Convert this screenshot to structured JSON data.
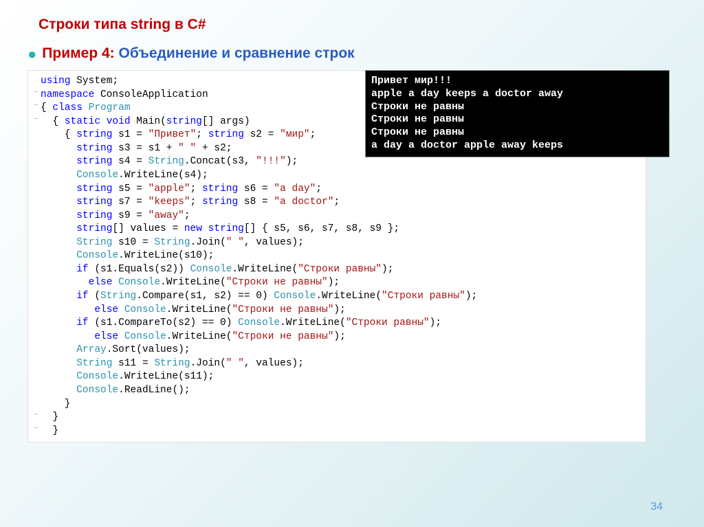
{
  "title": "Строки типа string в C#",
  "subtitle_prefix": "Пример 4:",
  "subtitle_text": " Объединение и сравнение строк",
  "page_number": "34",
  "console_output": [
    "Привет мир!!!",
    "apple a day keeps a doctor away",
    "Строки не равны",
    "Строки не равны",
    "Строки не равны",
    "a day a doctor apple away keeps"
  ],
  "code": {
    "lines": [
      {
        "g": " ",
        "tokens": [
          [
            "kw",
            "using"
          ],
          [
            "punc",
            " "
          ],
          [
            "ident",
            "System"
          ],
          [
            "punc",
            ";"
          ]
        ]
      },
      {
        "g": "−",
        "tokens": [
          [
            "kw",
            "namespace"
          ],
          [
            "punc",
            " "
          ],
          [
            "ident",
            "ConsoleApplication"
          ]
        ]
      },
      {
        "g": "−",
        "tokens": [
          [
            "punc",
            "{ "
          ],
          [
            "kw",
            "class"
          ],
          [
            "punc",
            " "
          ],
          [
            "type",
            "Program"
          ]
        ]
      },
      {
        "g": "−",
        "tokens": [
          [
            "punc",
            "  { "
          ],
          [
            "kw",
            "static"
          ],
          [
            "punc",
            " "
          ],
          [
            "kw",
            "void"
          ],
          [
            "punc",
            " "
          ],
          [
            "ident",
            "Main"
          ],
          [
            "punc",
            "("
          ],
          [
            "kw",
            "string"
          ],
          [
            "punc",
            "[] args)"
          ]
        ]
      },
      {
        "g": " ",
        "tokens": [
          [
            "punc",
            "    { "
          ],
          [
            "kw",
            "string"
          ],
          [
            "punc",
            " s1 = "
          ],
          [
            "str",
            "\"Привет\""
          ],
          [
            "punc",
            "; "
          ],
          [
            "kw",
            "string"
          ],
          [
            "punc",
            " s2 = "
          ],
          [
            "str",
            "\"мир\""
          ],
          [
            "punc",
            ";"
          ]
        ]
      },
      {
        "g": " ",
        "tokens": [
          [
            "punc",
            "      "
          ],
          [
            "kw",
            "string"
          ],
          [
            "punc",
            " s3 = s1 + "
          ],
          [
            "str",
            "\" \""
          ],
          [
            "punc",
            " + s2;"
          ]
        ]
      },
      {
        "g": " ",
        "tokens": [
          [
            "punc",
            "      "
          ],
          [
            "kw",
            "string"
          ],
          [
            "punc",
            " s4 = "
          ],
          [
            "type",
            "String"
          ],
          [
            "punc",
            ".Concat(s3, "
          ],
          [
            "str",
            "\"!!!\""
          ],
          [
            "punc",
            ");"
          ]
        ]
      },
      {
        "g": " ",
        "tokens": [
          [
            "punc",
            "      "
          ],
          [
            "type",
            "Console"
          ],
          [
            "punc",
            ".WriteLine(s4);"
          ]
        ]
      },
      {
        "g": " ",
        "tokens": [
          [
            "punc",
            "      "
          ],
          [
            "kw",
            "string"
          ],
          [
            "punc",
            " s5 = "
          ],
          [
            "str",
            "\"apple\""
          ],
          [
            "punc",
            "; "
          ],
          [
            "kw",
            "string"
          ],
          [
            "punc",
            " s6 = "
          ],
          [
            "str",
            "\"a day\""
          ],
          [
            "punc",
            ";"
          ]
        ]
      },
      {
        "g": " ",
        "tokens": [
          [
            "punc",
            "      "
          ],
          [
            "kw",
            "string"
          ],
          [
            "punc",
            " s7 = "
          ],
          [
            "str",
            "\"keeps\""
          ],
          [
            "punc",
            "; "
          ],
          [
            "kw",
            "string"
          ],
          [
            "punc",
            " s8 = "
          ],
          [
            "str",
            "\"a doctor\""
          ],
          [
            "punc",
            ";"
          ]
        ]
      },
      {
        "g": " ",
        "tokens": [
          [
            "punc",
            "      "
          ],
          [
            "kw",
            "string"
          ],
          [
            "punc",
            " s9 = "
          ],
          [
            "str",
            "\"away\""
          ],
          [
            "punc",
            ";"
          ]
        ]
      },
      {
        "g": " ",
        "tokens": [
          [
            "punc",
            "      "
          ],
          [
            "kw",
            "string"
          ],
          [
            "punc",
            "[] values = "
          ],
          [
            "kw",
            "new"
          ],
          [
            "punc",
            " "
          ],
          [
            "kw",
            "string"
          ],
          [
            "punc",
            "[] { s5, s6, s7, s8, s9 };"
          ]
        ]
      },
      {
        "g": " ",
        "tokens": [
          [
            "punc",
            "      "
          ],
          [
            "type",
            "String"
          ],
          [
            "punc",
            " s10 = "
          ],
          [
            "type",
            "String"
          ],
          [
            "punc",
            ".Join("
          ],
          [
            "str",
            "\" \""
          ],
          [
            "punc",
            ", values);"
          ]
        ]
      },
      {
        "g": " ",
        "tokens": [
          [
            "punc",
            "      "
          ],
          [
            "type",
            "Console"
          ],
          [
            "punc",
            ".WriteLine(s10);"
          ]
        ]
      },
      {
        "g": " ",
        "tokens": [
          [
            "punc",
            "      "
          ],
          [
            "kw",
            "if"
          ],
          [
            "punc",
            " (s1.Equals(s2)) "
          ],
          [
            "type",
            "Console"
          ],
          [
            "punc",
            ".WriteLine("
          ],
          [
            "str",
            "\"Строки равны\""
          ],
          [
            "punc",
            ");"
          ]
        ]
      },
      {
        "g": " ",
        "tokens": [
          [
            "punc",
            "        "
          ],
          [
            "kw",
            "else"
          ],
          [
            "punc",
            " "
          ],
          [
            "type",
            "Console"
          ],
          [
            "punc",
            ".WriteLine("
          ],
          [
            "str",
            "\"Строки не равны\""
          ],
          [
            "punc",
            ");"
          ]
        ]
      },
      {
        "g": " ",
        "tokens": [
          [
            "punc",
            "      "
          ],
          [
            "kw",
            "if"
          ],
          [
            "punc",
            " ("
          ],
          [
            "type",
            "String"
          ],
          [
            "punc",
            ".Compare(s1, s2) == 0) "
          ],
          [
            "type",
            "Console"
          ],
          [
            "punc",
            ".WriteLine("
          ],
          [
            "str",
            "\"Строки равны\""
          ],
          [
            "punc",
            ");"
          ]
        ]
      },
      {
        "g": " ",
        "tokens": [
          [
            "punc",
            "         "
          ],
          [
            "kw",
            "else"
          ],
          [
            "punc",
            " "
          ],
          [
            "type",
            "Console"
          ],
          [
            "punc",
            ".WriteLine("
          ],
          [
            "str",
            "\"Строки не равны\""
          ],
          [
            "punc",
            ");"
          ]
        ]
      },
      {
        "g": " ",
        "tokens": [
          [
            "punc",
            "      "
          ],
          [
            "kw",
            "if"
          ],
          [
            "punc",
            " (s1.CompareTo(s2) == 0) "
          ],
          [
            "type",
            "Console"
          ],
          [
            "punc",
            ".WriteLine("
          ],
          [
            "str",
            "\"Строки равны\""
          ],
          [
            "punc",
            ");"
          ]
        ]
      },
      {
        "g": " ",
        "tokens": [
          [
            "punc",
            "         "
          ],
          [
            "kw",
            "else"
          ],
          [
            "punc",
            " "
          ],
          [
            "type",
            "Console"
          ],
          [
            "punc",
            ".WriteLine("
          ],
          [
            "str",
            "\"Строки не равны\""
          ],
          [
            "punc",
            ");"
          ]
        ]
      },
      {
        "g": " ",
        "tokens": [
          [
            "punc",
            "      "
          ],
          [
            "type",
            "Array"
          ],
          [
            "punc",
            ".Sort(values);"
          ]
        ]
      },
      {
        "g": " ",
        "tokens": [
          [
            "punc",
            "      "
          ],
          [
            "type",
            "String"
          ],
          [
            "punc",
            " s11 = "
          ],
          [
            "type",
            "String"
          ],
          [
            "punc",
            ".Join("
          ],
          [
            "str",
            "\" \""
          ],
          [
            "punc",
            ", values);"
          ]
        ]
      },
      {
        "g": " ",
        "tokens": [
          [
            "punc",
            "      "
          ],
          [
            "type",
            "Console"
          ],
          [
            "punc",
            ".WriteLine(s11);"
          ]
        ]
      },
      {
        "g": " ",
        "tokens": [
          [
            "punc",
            "      "
          ],
          [
            "type",
            "Console"
          ],
          [
            "punc",
            ".ReadLine();"
          ]
        ]
      },
      {
        "g": " ",
        "tokens": [
          [
            "punc",
            "    }"
          ]
        ]
      },
      {
        "g": "−",
        "tokens": [
          [
            "punc",
            "  }"
          ]
        ]
      },
      {
        "g": "−",
        "tokens": [
          [
            "punc",
            "  }"
          ]
        ]
      }
    ]
  }
}
